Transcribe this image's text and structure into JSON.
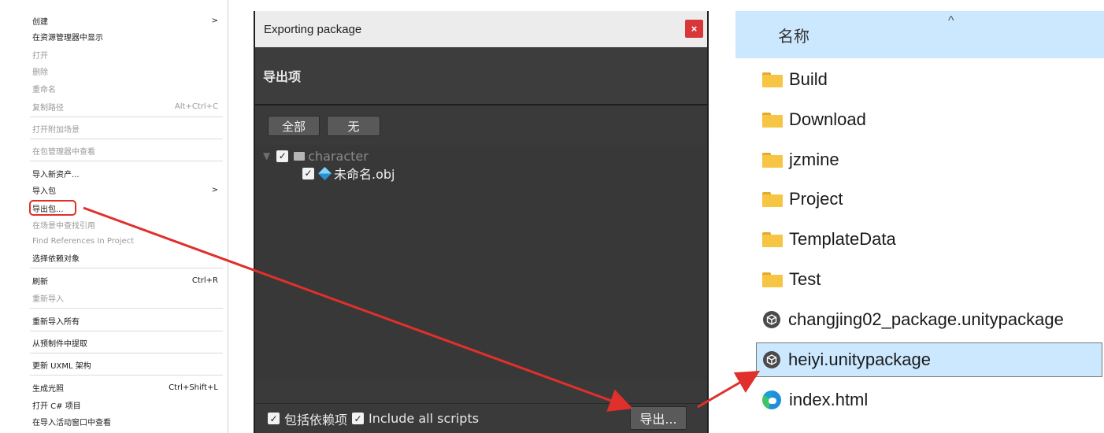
{
  "context_menu": {
    "items": [
      {
        "label": "创建",
        "shortcut": "",
        "submenu": ">",
        "disabled": false
      },
      {
        "label": "在资源管理器中显示",
        "shortcut": "",
        "submenu": "",
        "disabled": false
      },
      {
        "label": "打开",
        "shortcut": "",
        "submenu": "",
        "disabled": true
      },
      {
        "label": "删除",
        "shortcut": "",
        "submenu": "",
        "disabled": true
      },
      {
        "label": "重命名",
        "shortcut": "",
        "submenu": "",
        "disabled": true
      },
      {
        "label": "复制路径",
        "shortcut": "Alt+Ctrl+C",
        "submenu": "",
        "disabled": true
      },
      {
        "label": "打开附加场景",
        "shortcut": "",
        "submenu": "",
        "disabled": true
      },
      {
        "label": "在包管理器中查看",
        "shortcut": "",
        "submenu": "",
        "disabled": true
      },
      {
        "label": "导入新资产...",
        "shortcut": "",
        "submenu": "",
        "disabled": false
      },
      {
        "label": "导入包",
        "shortcut": "",
        "submenu": ">",
        "disabled": false
      },
      {
        "label": "导出包...",
        "shortcut": "",
        "submenu": "",
        "disabled": false
      },
      {
        "label": "在场景中查找引用",
        "shortcut": "",
        "submenu": "",
        "disabled": true
      },
      {
        "label": "Find References In Project",
        "shortcut": "",
        "submenu": "",
        "disabled": true
      },
      {
        "label": "选择依赖对象",
        "shortcut": "",
        "submenu": "",
        "disabled": false
      },
      {
        "label": "刷新",
        "shortcut": "Ctrl+R",
        "submenu": "",
        "disabled": false
      },
      {
        "label": "重新导入",
        "shortcut": "",
        "submenu": "",
        "disabled": true
      },
      {
        "label": "重新导入所有",
        "shortcut": "",
        "submenu": "",
        "disabled": false
      },
      {
        "label": "从预制件中提取",
        "shortcut": "",
        "submenu": "",
        "disabled": false
      },
      {
        "label": "更新 UXML 架构",
        "shortcut": "",
        "submenu": "",
        "disabled": false
      },
      {
        "label": "生成光照",
        "shortcut": "Ctrl+Shift+L",
        "submenu": "",
        "disabled": false
      },
      {
        "label": "打开 C# 项目",
        "shortcut": "",
        "submenu": "",
        "disabled": false
      },
      {
        "label": "在导入活动窗口中查看",
        "shortcut": "",
        "submenu": "",
        "disabled": false
      }
    ]
  },
  "dialog": {
    "title": "Exporting package",
    "close_glyph": "×",
    "header": "导出项",
    "select_all_label": "全部",
    "select_none_label": "无",
    "tree": {
      "folder_name": "character",
      "file_name": "未命名.obj"
    },
    "include_dependencies_label": "包括依赖项",
    "include_scripts_label": "Include all scripts",
    "export_label": "导出...",
    "check_glyph": "✓"
  },
  "explorer": {
    "column_name": "名称",
    "sort_caret": "^",
    "files": [
      {
        "name": "Build",
        "type": "folder"
      },
      {
        "name": "Download",
        "type": "folder"
      },
      {
        "name": "jzmine",
        "type": "folder"
      },
      {
        "name": "Project",
        "type": "folder"
      },
      {
        "name": "TemplateData",
        "type": "folder"
      },
      {
        "name": "Test",
        "type": "folder"
      },
      {
        "name": "changjing02_package.unitypackage",
        "type": "unitypackage"
      },
      {
        "name": "heiyi.unitypackage",
        "type": "unitypackage"
      },
      {
        "name": "index.html",
        "type": "html"
      }
    ]
  },
  "colors": {
    "annotation_red": "#e0302c",
    "selection_blue": "#cce8ff",
    "dialog_dark": "#3a3a3a"
  }
}
